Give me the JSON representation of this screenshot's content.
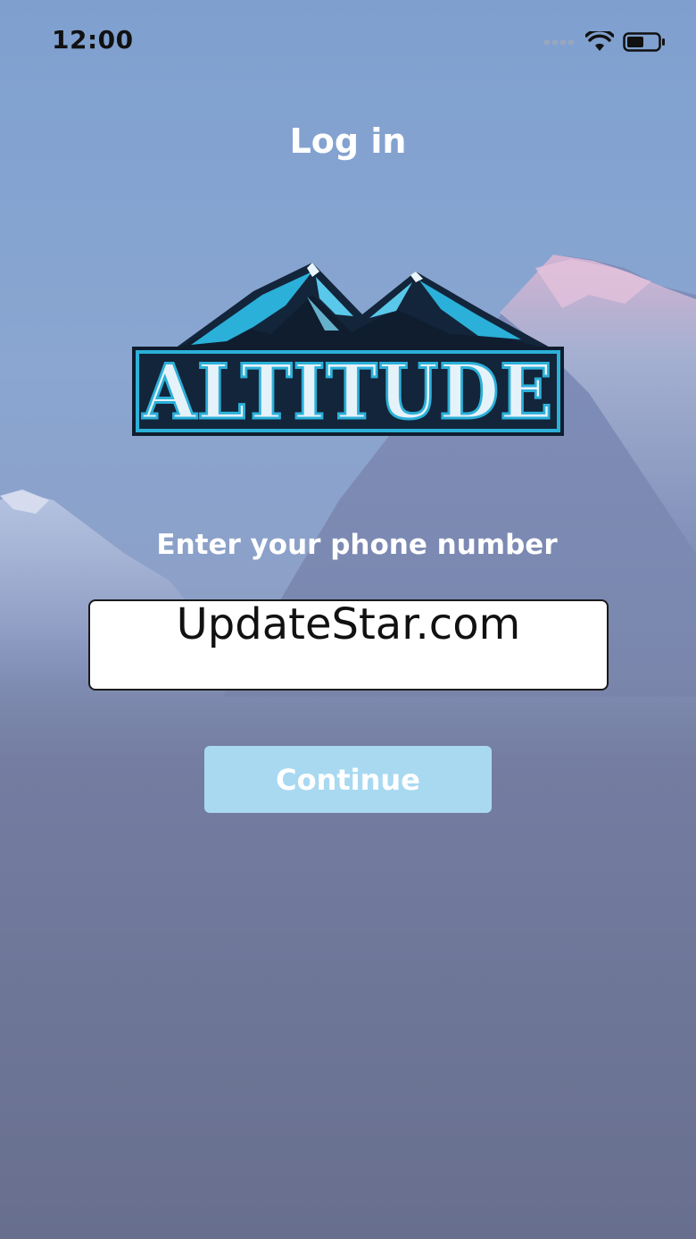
{
  "status_bar": {
    "time": "12:00",
    "icons": [
      "signal-icon",
      "wifi-icon",
      "battery-icon"
    ]
  },
  "header": {
    "title": "Log in"
  },
  "logo": {
    "text": "ALTITUDE",
    "icon": "mountain-logo",
    "colors": {
      "dark": "#13253a",
      "blue": "#2bb0d9",
      "light_text": "#e6f2fa"
    }
  },
  "form": {
    "prompt": "Enter your phone number",
    "phone_value": "UpdateStar.com",
    "continue_label": "Continue"
  },
  "colors": {
    "button_bg": "#a9d9f1",
    "sky_top": "#7fa0cf",
    "sky_bottom": "#686f8e"
  }
}
